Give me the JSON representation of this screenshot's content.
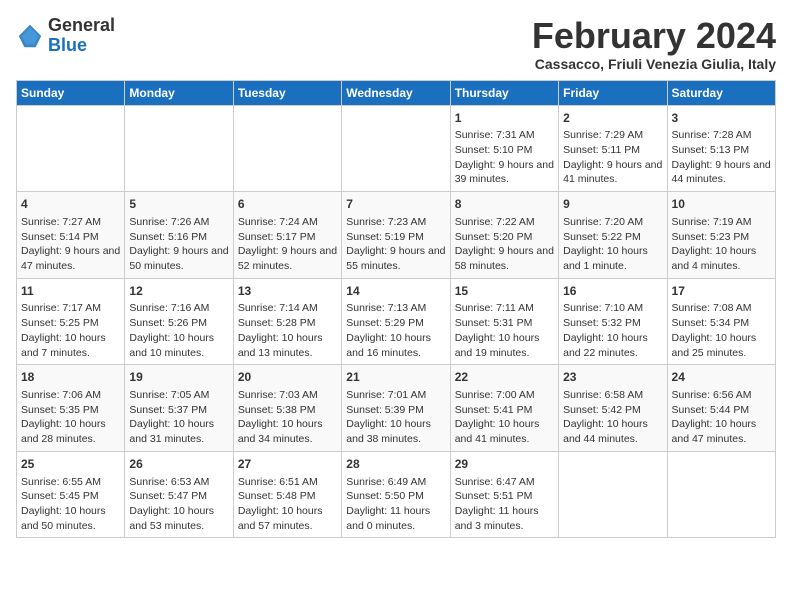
{
  "header": {
    "logo_general": "General",
    "logo_blue": "Blue",
    "title": "February 2024",
    "subtitle": "Cassacco, Friuli Venezia Giulia, Italy"
  },
  "days_of_week": [
    "Sunday",
    "Monday",
    "Tuesday",
    "Wednesday",
    "Thursday",
    "Friday",
    "Saturday"
  ],
  "weeks": [
    [
      {
        "day": "",
        "info": ""
      },
      {
        "day": "",
        "info": ""
      },
      {
        "day": "",
        "info": ""
      },
      {
        "day": "",
        "info": ""
      },
      {
        "day": "1",
        "info": "Sunrise: 7:31 AM\nSunset: 5:10 PM\nDaylight: 9 hours and 39 minutes."
      },
      {
        "day": "2",
        "info": "Sunrise: 7:29 AM\nSunset: 5:11 PM\nDaylight: 9 hours and 41 minutes."
      },
      {
        "day": "3",
        "info": "Sunrise: 7:28 AM\nSunset: 5:13 PM\nDaylight: 9 hours and 44 minutes."
      }
    ],
    [
      {
        "day": "4",
        "info": "Sunrise: 7:27 AM\nSunset: 5:14 PM\nDaylight: 9 hours and 47 minutes."
      },
      {
        "day": "5",
        "info": "Sunrise: 7:26 AM\nSunset: 5:16 PM\nDaylight: 9 hours and 50 minutes."
      },
      {
        "day": "6",
        "info": "Sunrise: 7:24 AM\nSunset: 5:17 PM\nDaylight: 9 hours and 52 minutes."
      },
      {
        "day": "7",
        "info": "Sunrise: 7:23 AM\nSunset: 5:19 PM\nDaylight: 9 hours and 55 minutes."
      },
      {
        "day": "8",
        "info": "Sunrise: 7:22 AM\nSunset: 5:20 PM\nDaylight: 9 hours and 58 minutes."
      },
      {
        "day": "9",
        "info": "Sunrise: 7:20 AM\nSunset: 5:22 PM\nDaylight: 10 hours and 1 minute."
      },
      {
        "day": "10",
        "info": "Sunrise: 7:19 AM\nSunset: 5:23 PM\nDaylight: 10 hours and 4 minutes."
      }
    ],
    [
      {
        "day": "11",
        "info": "Sunrise: 7:17 AM\nSunset: 5:25 PM\nDaylight: 10 hours and 7 minutes."
      },
      {
        "day": "12",
        "info": "Sunrise: 7:16 AM\nSunset: 5:26 PM\nDaylight: 10 hours and 10 minutes."
      },
      {
        "day": "13",
        "info": "Sunrise: 7:14 AM\nSunset: 5:28 PM\nDaylight: 10 hours and 13 minutes."
      },
      {
        "day": "14",
        "info": "Sunrise: 7:13 AM\nSunset: 5:29 PM\nDaylight: 10 hours and 16 minutes."
      },
      {
        "day": "15",
        "info": "Sunrise: 7:11 AM\nSunset: 5:31 PM\nDaylight: 10 hours and 19 minutes."
      },
      {
        "day": "16",
        "info": "Sunrise: 7:10 AM\nSunset: 5:32 PM\nDaylight: 10 hours and 22 minutes."
      },
      {
        "day": "17",
        "info": "Sunrise: 7:08 AM\nSunset: 5:34 PM\nDaylight: 10 hours and 25 minutes."
      }
    ],
    [
      {
        "day": "18",
        "info": "Sunrise: 7:06 AM\nSunset: 5:35 PM\nDaylight: 10 hours and 28 minutes."
      },
      {
        "day": "19",
        "info": "Sunrise: 7:05 AM\nSunset: 5:37 PM\nDaylight: 10 hours and 31 minutes."
      },
      {
        "day": "20",
        "info": "Sunrise: 7:03 AM\nSunset: 5:38 PM\nDaylight: 10 hours and 34 minutes."
      },
      {
        "day": "21",
        "info": "Sunrise: 7:01 AM\nSunset: 5:39 PM\nDaylight: 10 hours and 38 minutes."
      },
      {
        "day": "22",
        "info": "Sunrise: 7:00 AM\nSunset: 5:41 PM\nDaylight: 10 hours and 41 minutes."
      },
      {
        "day": "23",
        "info": "Sunrise: 6:58 AM\nSunset: 5:42 PM\nDaylight: 10 hours and 44 minutes."
      },
      {
        "day": "24",
        "info": "Sunrise: 6:56 AM\nSunset: 5:44 PM\nDaylight: 10 hours and 47 minutes."
      }
    ],
    [
      {
        "day": "25",
        "info": "Sunrise: 6:55 AM\nSunset: 5:45 PM\nDaylight: 10 hours and 50 minutes."
      },
      {
        "day": "26",
        "info": "Sunrise: 6:53 AM\nSunset: 5:47 PM\nDaylight: 10 hours and 53 minutes."
      },
      {
        "day": "27",
        "info": "Sunrise: 6:51 AM\nSunset: 5:48 PM\nDaylight: 10 hours and 57 minutes."
      },
      {
        "day": "28",
        "info": "Sunrise: 6:49 AM\nSunset: 5:50 PM\nDaylight: 11 hours and 0 minutes."
      },
      {
        "day": "29",
        "info": "Sunrise: 6:47 AM\nSunset: 5:51 PM\nDaylight: 11 hours and 3 minutes."
      },
      {
        "day": "",
        "info": ""
      },
      {
        "day": "",
        "info": ""
      }
    ]
  ]
}
